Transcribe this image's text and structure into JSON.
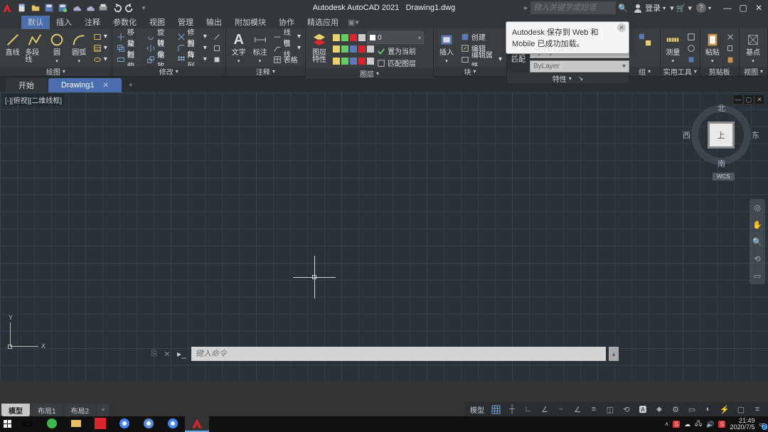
{
  "title": {
    "app": "Autodesk AutoCAD 2021",
    "file": "Drawing1.dwg"
  },
  "search_placeholder": "键入关键字或短语",
  "login_label": "登录",
  "menus": {
    "m0": "默认",
    "m1": "插入",
    "m2": "注释",
    "m3": "参数化",
    "m4": "视图",
    "m5": "管理",
    "m6": "输出",
    "m7": "附加模块",
    "m8": "协作",
    "m9": "精选应用"
  },
  "draw": {
    "line": "直线",
    "polyline": "多段线",
    "circle": "圆",
    "arc": "圆弧",
    "title": "绘图"
  },
  "modify": {
    "move": "移动",
    "rotate": "旋转",
    "trim": "修剪",
    "copy": "复制",
    "mirror": "镜像",
    "fillet": "圆角",
    "stretch": "拉伸",
    "scale": "缩放",
    "array": "阵列",
    "title": "修改"
  },
  "annot": {
    "text": "文字",
    "dim": "标注",
    "linear": "线性",
    "leader": "引线",
    "table": "表格",
    "title": "注释"
  },
  "layers": {
    "big": "图层\n特性",
    "current": "置为当前",
    "match": "匹配图层",
    "layer0": "0",
    "title": "图层"
  },
  "block": {
    "insert": "插入",
    "create": "创建",
    "edit": "编辑",
    "editattr": "编辑属性",
    "title": "块"
  },
  "props": {
    "big": "特性\n匹配",
    "bylayer": "ByLayer",
    "title": "特性"
  },
  "groups": {
    "title": "组"
  },
  "utils": {
    "big": "测量",
    "title": "实用工具"
  },
  "clip": {
    "big": "粘贴",
    "title": "剪贴板"
  },
  "view": {
    "big": "基点",
    "title": "视图"
  },
  "doctabs": {
    "home": "开始",
    "drawing": "Drawing1"
  },
  "viewport_label": "[-][俯视][二维线框]",
  "viewcube": {
    "top": "上",
    "n": "北",
    "s": "南",
    "e": "东",
    "w": "西",
    "wcs": "WCS"
  },
  "ucs": {
    "x": "X",
    "y": "Y"
  },
  "cmd_placeholder": "键入命令",
  "layouts": {
    "model": "模型",
    "l1": "布局1",
    "l2": "布局2"
  },
  "status": {
    "model": "模型"
  },
  "balloon": "Autodesk 保存到 Web 和 Mobile 已成功加载。",
  "clock": {
    "time": "21:49",
    "date": "2020/7/5"
  },
  "tray_count": "2"
}
